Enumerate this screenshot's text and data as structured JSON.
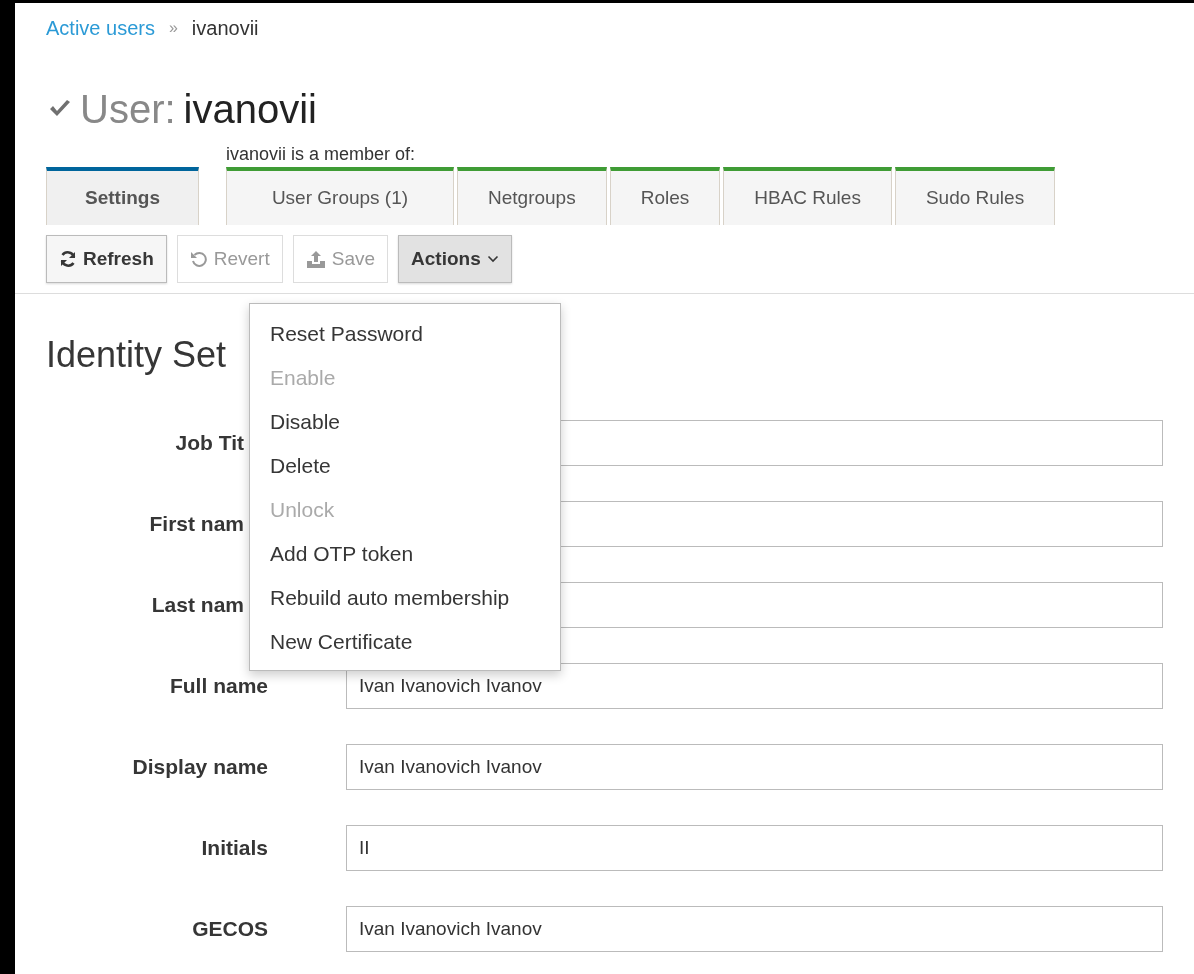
{
  "breadcrumb": {
    "link": "Active users",
    "separator": "»",
    "current": "ivanovii"
  },
  "title": {
    "prefix": "User:",
    "name": "ivanovii"
  },
  "member_of_label": "ivanovii is a member of:",
  "tabs": [
    {
      "label": "Settings",
      "selected": true,
      "kind": "settings"
    },
    {
      "label": "User Groups (1)",
      "selected": false,
      "kind": "membership"
    },
    {
      "label": "Netgroups",
      "selected": false,
      "kind": "membership"
    },
    {
      "label": "Roles",
      "selected": false,
      "kind": "membership"
    },
    {
      "label": "HBAC Rules",
      "selected": false,
      "kind": "membership"
    },
    {
      "label": "Sudo Rules",
      "selected": false,
      "kind": "membership"
    }
  ],
  "toolbar": [
    {
      "label": "Refresh",
      "kind": "refresh",
      "disabled": false,
      "expanded": false
    },
    {
      "label": "Revert",
      "kind": "revert",
      "disabled": true,
      "expanded": false
    },
    {
      "label": "Save",
      "kind": "save",
      "disabled": true,
      "expanded": false
    },
    {
      "label": "Actions",
      "kind": "dropdown",
      "disabled": false,
      "expanded": true
    }
  ],
  "actions_menu": [
    {
      "label": "Reset Password",
      "disabled": false
    },
    {
      "label": "Enable",
      "disabled": true
    },
    {
      "label": "Disable",
      "disabled": false
    },
    {
      "label": "Delete",
      "disabled": false
    },
    {
      "label": "Unlock",
      "disabled": true
    },
    {
      "label": "Add OTP token",
      "disabled": false
    },
    {
      "label": "Rebuild auto membership",
      "disabled": false
    },
    {
      "label": "New Certificate",
      "disabled": false
    }
  ],
  "section_title": "Identity Set",
  "fields": [
    {
      "label": "Job Tit",
      "cut_by_menu": true
    },
    {
      "label": "First nam",
      "cut_by_menu": true
    },
    {
      "label": "Last nam",
      "cut_by_menu": true
    },
    {
      "label": "Full name",
      "value": "Ivan Ivanovich Ivanov"
    },
    {
      "label": "Display name",
      "value": "Ivan Ivanovich Ivanov"
    },
    {
      "label": "Initials",
      "value": "II"
    },
    {
      "label": "GECOS",
      "value": "Ivan Ivanovich Ivanov"
    }
  ]
}
